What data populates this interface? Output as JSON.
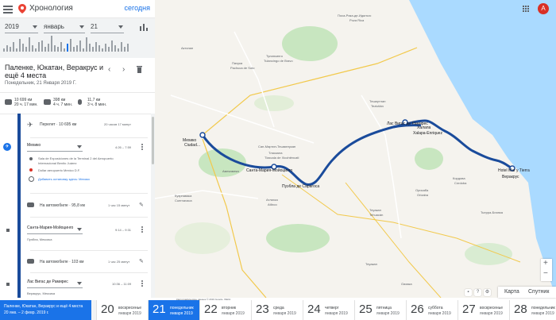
{
  "app": {
    "title": "Хронология",
    "today": "сегодня"
  },
  "selectors": {
    "year": "2019",
    "month": "январь",
    "day": "21"
  },
  "day": {
    "title": "Паленке, Юкатан, Веракрус и ещё 4 места",
    "subtitle": "Понедельник, 21 Января 2019 Г."
  },
  "stats": [
    {
      "line1": "10 699 км",
      "line2": "20 ч. 17 мин."
    },
    {
      "line1": "398 км",
      "line2": "4 ч. 7 мин."
    },
    {
      "line1": "11,7 км",
      "line2": "3 ч. 8 мин."
    }
  ],
  "timeline": {
    "flight": {
      "label": "Перелет · 10 695 км",
      "duration": "20 часов 17 минут"
    },
    "place1": {
      "name": "Мехико",
      "time": "4:26 – 7:59",
      "detail1a": "Sala de Exposiciones de la Terminal 2 del Aeropuerto",
      "detail1b": "Internacional Benito Juárez",
      "detail2": "Dollar aeropuerto Mexico D.F.",
      "detail3": "Добавить остановку здесь: Мехико"
    },
    "drive1": {
      "label": "На автомобиле · 95,8 км",
      "duration": "1 час 15 минут"
    },
    "place2": {
      "name": "Санта-Мария-Мойоцинго",
      "time": "9:14 – 9:31",
      "sub": "Пуэбла, Мексика"
    },
    "drive2": {
      "label": "На автомобиле · 103 км",
      "duration": "1 час 25 минут"
    },
    "place3": {
      "name": "Лас Вигас де Рамирес",
      "time": "10:36 – 11:09",
      "sub": "Веракрус, Мексика"
    }
  },
  "map": {
    "labels_big": [
      "Мехико",
      "Ciudad...",
      "Мехико",
      "Санта-Мария-Мойоцинго",
      "Лас Вигас де Рамирес",
      "Hotel Mar y Tierra",
      "Пуэбла де Сарагоса",
      "Xalapa-Enriquez",
      "Халапа",
      "Веракрус"
    ],
    "labels": [
      "Поса-Рика-де-Идальго",
      "Poza Rica",
      "Пачука",
      "Pachuca de Soto",
      "Тулансинго",
      "Tulancingo de Bravo",
      "Актопан",
      "Тешиутлан",
      "Teziutlán",
      "Тласкала",
      "Tlaxcala de Xicohténcatl",
      "Сан-Мартин-Тешмелукан",
      "Амекамека",
      "Куэрнавака",
      "Cuernavaca",
      "Атлихко",
      "Atlixco",
      "Теуакан",
      "Tehuacán",
      "Орисаба",
      "Orizaba",
      "Кордова",
      "Córdoba",
      "Тьерра-Бланка",
      "Теуакан",
      "Оахака"
    ],
    "maptype_map": "Карта",
    "maptype_sat": "Спутник",
    "attribution": "Картографические данные © 2019 Google, INEGI",
    "avatar": "A"
  },
  "strip": {
    "trip_line1": "Паленке, Юкатан, Веракрус и ещё 4 места",
    "trip_line2": "20 янв. – 2 февр. 2019 г.",
    "days": [
      {
        "n": "20",
        "w": "воскресенье",
        "m": "января 2019"
      },
      {
        "n": "21",
        "w": "понедельник",
        "m": "января 2019"
      },
      {
        "n": "22",
        "w": "вторник",
        "m": "января 2019"
      },
      {
        "n": "23",
        "w": "среда",
        "m": "января 2019"
      },
      {
        "n": "24",
        "w": "четверг",
        "m": "января 2019"
      },
      {
        "n": "25",
        "w": "пятница",
        "m": "января 2019"
      },
      {
        "n": "26",
        "w": "суббота",
        "m": "января 2019"
      },
      {
        "n": "27",
        "w": "воскресенье",
        "m": "января 2019"
      },
      {
        "n": "28",
        "w": "понедельник",
        "m": "января 2019"
      }
    ]
  },
  "colors": {
    "accent": "#1a73e8",
    "route": "#1a4b9b",
    "water": "#aadaff",
    "park": "#c8e6c0"
  }
}
